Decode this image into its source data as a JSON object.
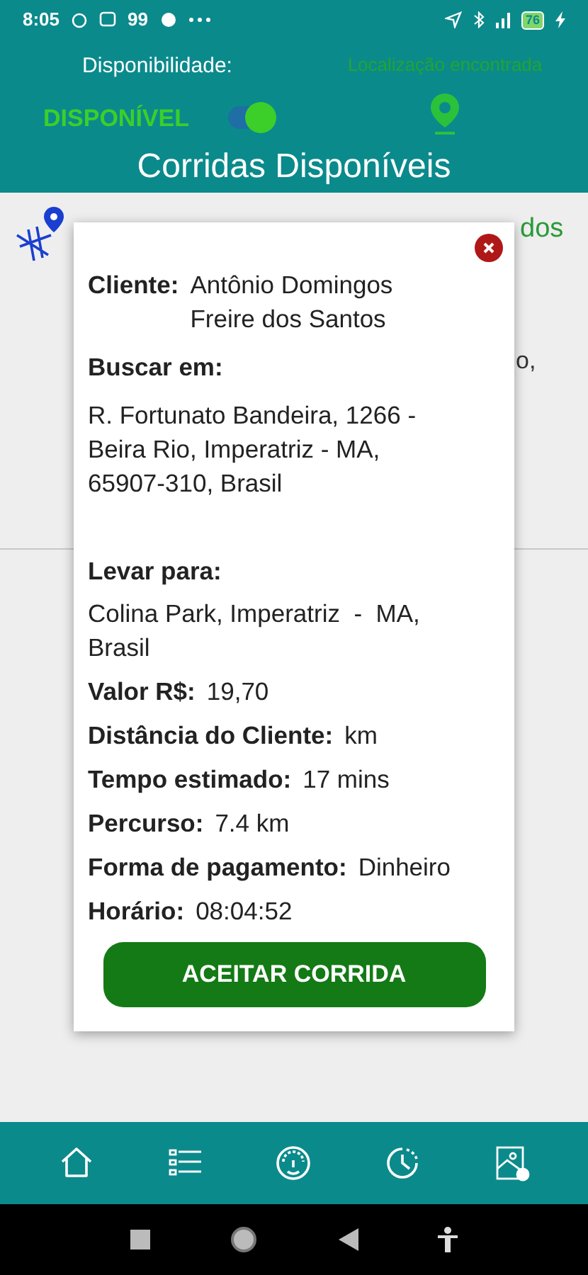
{
  "status_bar": {
    "time": "8:05",
    "notification_count": "99",
    "battery": "76"
  },
  "header": {
    "availability_label": "Disponibilidade:",
    "availability_status": "DISPONÍVEL",
    "availability_switch": {
      "on": true
    },
    "location_status": "Localização encontrada",
    "title": "Corridas Disponíveis"
  },
  "background_ride": {
    "title_fragment": "dos",
    "address_fragment": "o,"
  },
  "ride_dialog": {
    "client_label": "Cliente:",
    "client_name": "Antônio Domingos Freire dos Santos",
    "pickup_label": "Buscar em:",
    "pickup_address": "R. Fortunato Bandeira, 1266 - Beira Rio, Imperatriz - MA, 65907-310, Brasil",
    "dropoff_label": "Levar para:",
    "dropoff_address": "Colina Park, Imperatriz  -  MA, Brasil",
    "details": [
      {
        "label": "Valor R$:",
        "value": "19,70"
      },
      {
        "label": "Distância do Cliente:",
        "value": "km"
      },
      {
        "label": "Tempo estimado:",
        "value": "17 mins"
      },
      {
        "label": "Percurso:",
        "value": "7.4 km"
      },
      {
        "label": "Forma de pagamento:",
        "value": "Dinheiro"
      },
      {
        "label": "Horário:",
        "value": "08:04:52"
      }
    ],
    "accept_button": "ACEITAR CORRIDA"
  },
  "bottom_nav": [
    {
      "kind": "home"
    },
    {
      "kind": "list"
    },
    {
      "kind": "gauge"
    },
    {
      "kind": "history"
    },
    {
      "kind": "map"
    }
  ]
}
